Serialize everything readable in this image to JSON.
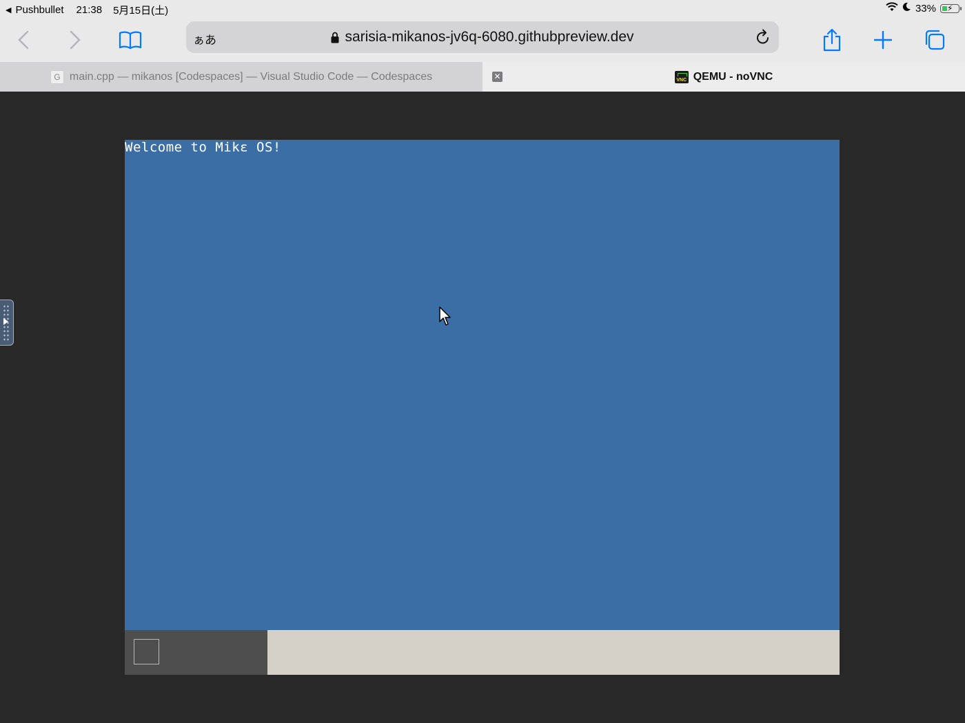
{
  "status_bar": {
    "back_app": "Pushbullet",
    "time": "21:38",
    "date": "5月15日(土)",
    "battery": "33%",
    "battery_level": 0.33,
    "battery_color": "#34c759"
  },
  "toolbar": {
    "back_icon": "chevron-left-icon",
    "forward_icon": "chevron-right-icon",
    "bookmarks_icon": "book-icon",
    "reader_label": "ぁあ",
    "url": "sarisia-mikanos-jv6q-6080.githubpreview.dev",
    "lock_icon": "lock-icon",
    "reload_icon": "reload-icon",
    "share_icon": "share-icon",
    "new_tab_icon": "plus-icon",
    "tabs_icon": "tabs-overview-icon",
    "accent_color": "#007aff"
  },
  "tabs": [
    {
      "title": "main.cpp — mikanos [Codespaces] — Visual Studio Code — Codespaces",
      "favicon_letter": "G",
      "active": false
    },
    {
      "title": "QEMU - noVNC",
      "favicon_label": "VNC",
      "active": true
    }
  ],
  "vnc": {
    "welcome_text": "Welcome to Mikε OS!",
    "desktop_color": "#3b6ea5",
    "taskbar_color": "#d5d0c8",
    "taskbar_start_color": "#4e4e4e"
  }
}
